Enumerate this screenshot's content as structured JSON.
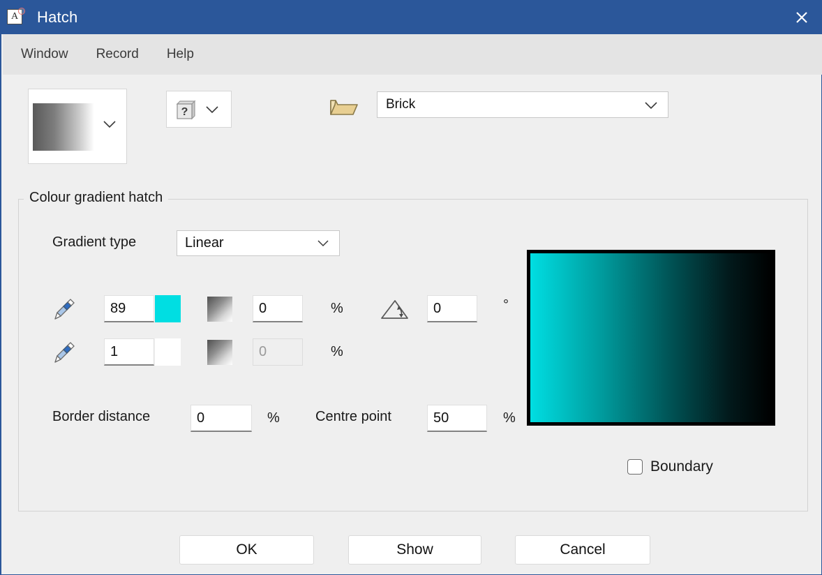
{
  "window": {
    "title": "Hatch",
    "app_icon": "document-a-icon",
    "close_icon": "close-icon",
    "titlebar_color": "#2b579a"
  },
  "menubar": {
    "items": [
      {
        "label": "Window",
        "name": "menu-window"
      },
      {
        "label": "Record",
        "name": "menu-record"
      },
      {
        "label": "Help",
        "name": "menu-help"
      }
    ]
  },
  "toolbar": {
    "gradient_picker": {
      "icon": "gradient-preview-swatch",
      "chevron": "chevron-down-icon"
    },
    "pattern_picker": {
      "icon": "question-box-icon",
      "chevron": "chevron-down-icon"
    },
    "open_folder_icon": "open-folder-icon",
    "preset": {
      "value": "Brick",
      "chevron": "chevron-down-icon"
    }
  },
  "group": {
    "legend": "Colour gradient hatch",
    "gradient_type": {
      "label": "Gradient type",
      "value": "Linear",
      "chevron": "chevron-down-icon"
    },
    "rows": [
      {
        "pencil_icon": "pencil-icon",
        "colour_index": "89",
        "swatch_color": "#00dee2",
        "gradient_icon": "gradient-square-icon",
        "transparency": "0",
        "percent": "%",
        "disabled": false
      },
      {
        "pencil_icon": "pencil-icon",
        "colour_index": "1",
        "swatch_color": "#ffffff",
        "gradient_icon": "gradient-square-icon",
        "transparency": "0",
        "percent": "%",
        "disabled": true
      }
    ],
    "angle": {
      "icon": "angle-icon",
      "value": "0",
      "unit": "°"
    },
    "border_distance": {
      "label": "Border distance",
      "value": "0",
      "unit": "%"
    },
    "centre_point": {
      "label": "Centre point",
      "value": "50",
      "unit": "%"
    },
    "preview": {
      "start_color": "#00dee2",
      "end_color": "#000000"
    },
    "boundary": {
      "label": "Boundary",
      "checked": false
    }
  },
  "footer": {
    "ok_label": "OK",
    "show_label": "Show",
    "cancel_label": "Cancel"
  }
}
